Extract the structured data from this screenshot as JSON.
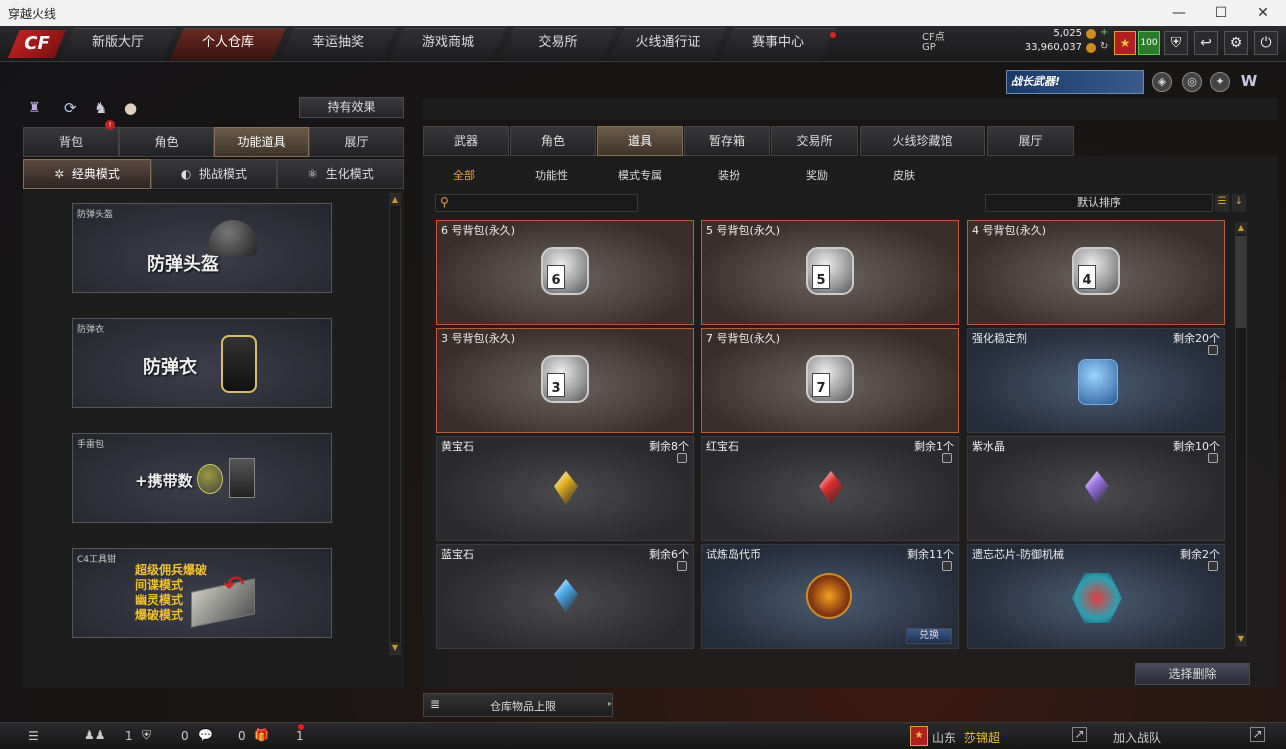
{
  "window": {
    "title": "穿越火线"
  },
  "nav": {
    "logo": "CF",
    "tabs": [
      "新版大厅",
      "个人仓库",
      "幸运抽奖",
      "游戏商城",
      "交易所",
      "火线通行证",
      "赛事中心"
    ],
    "active_index": 1
  },
  "currency": {
    "cf_label": "CF点",
    "cf_value": "5,025",
    "gp_label": "GP",
    "gp_value": "33,960,037",
    "level_badge": "100"
  },
  "banner": {
    "text": "战长武器!"
  },
  "left": {
    "effects_button": "持有效果",
    "tabs": [
      "背包",
      "角色",
      "功能道具",
      "展厅"
    ],
    "active_tab": 2,
    "modes": [
      "经典模式",
      "挑战模式",
      "生化模式"
    ],
    "active_mode": 0,
    "cards": [
      {
        "caption": "防弹头盔",
        "big": "防弹头盔"
      },
      {
        "caption": "防弹衣",
        "big": "防弹衣"
      },
      {
        "caption": "手雷包",
        "big": "+携带数"
      },
      {
        "caption": "C4工具钳",
        "lines": [
          "超级佣兵爆破",
          "间谍模式",
          "幽灵模式",
          "爆破模式"
        ]
      }
    ]
  },
  "right": {
    "tabs": [
      "武器",
      "角色",
      "道具",
      "暂存箱",
      "交易所",
      "火线珍藏馆",
      "展厅"
    ],
    "active_tab": 2,
    "subtabs": [
      "全部",
      "功能性",
      "模式专属",
      "装扮",
      "奖励",
      "皮肤"
    ],
    "active_subtab": 0,
    "search_placeholder": "",
    "sort_label": "默认排序",
    "items": [
      {
        "name": "6 号背包(永久)",
        "remain": "",
        "kind": "bag",
        "num": "6"
      },
      {
        "name": "5 号背包(永久)",
        "remain": "",
        "kind": "bag",
        "num": "5"
      },
      {
        "name": "4 号背包(永久)",
        "remain": "",
        "kind": "bag",
        "num": "4"
      },
      {
        "name": "3 号背包(永久)",
        "remain": "",
        "kind": "bag",
        "num": "3"
      },
      {
        "name": "7 号背包(永久)",
        "remain": "",
        "kind": "bag",
        "num": "7"
      },
      {
        "name": "强化稳定剂",
        "remain": "剩余20个",
        "kind": "stabilizer",
        "num": ""
      },
      {
        "name": "黄宝石",
        "remain": "剩余8个",
        "kind": "gem",
        "color": "#e0b020"
      },
      {
        "name": "红宝石",
        "remain": "剩余1个",
        "kind": "gem",
        "color": "#e03030"
      },
      {
        "name": "紫水晶",
        "remain": "剩余10个",
        "kind": "gem",
        "color": "#9a70e0"
      },
      {
        "name": "蓝宝石",
        "remain": "剩余6个",
        "kind": "gem",
        "color": "#4aa8e8"
      },
      {
        "name": "试炼岛代币",
        "remain": "剩余11个",
        "kind": "token",
        "action": "兑换"
      },
      {
        "name": "遗忘芯片-防御机械",
        "remain": "剩余2个",
        "kind": "chip"
      }
    ],
    "delete_button": "选择删除",
    "storage_limit": "仓库物品上限"
  },
  "bottom": {
    "counts": [
      "1",
      "0",
      "0",
      "1"
    ],
    "region": "山东",
    "player": "莎锦超",
    "join_team": "加入战队"
  },
  "colors": {
    "accent": "#c05a30",
    "active_orange": "#f0a030"
  }
}
